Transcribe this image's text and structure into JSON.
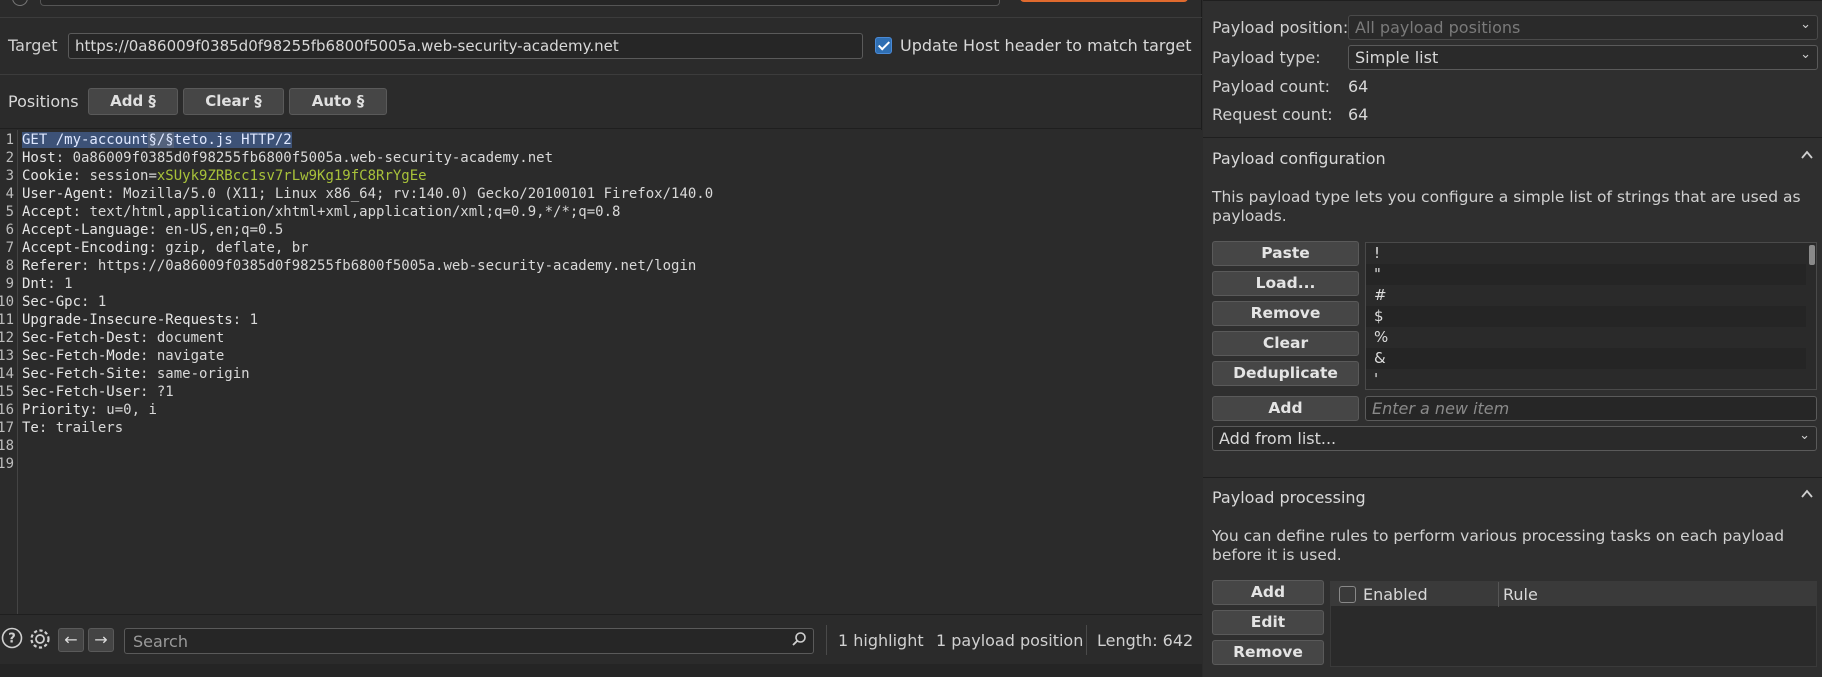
{
  "target": {
    "label": "Target",
    "url": "https://0a86009f0385d0f98255fb6800f5005a.web-security-academy.net",
    "update_host_label": "Update Host header to match target",
    "update_host_checked": true
  },
  "positions": {
    "label": "Positions",
    "add_label": "Add §",
    "clear_label": "Clear §",
    "auto_label": "Auto §"
  },
  "request": {
    "line_numbers": [
      "1",
      "2",
      "3",
      "4",
      "5",
      "6",
      "7",
      "8",
      "9",
      "10",
      "11",
      "12",
      "13",
      "14",
      "15",
      "16",
      "17",
      "18",
      "19"
    ],
    "line1_a": "GET /my-account",
    "line1_marker": "§/§",
    "line1_b": "teto.js HTTP/2",
    "headers": [
      {
        "name": "Host",
        "value": "0a86009f0385d0f98255fb6800f5005a.web-security-academy.net"
      },
      {
        "name": "Cookie",
        "value": "session=",
        "extra": "xSUyk9ZRBcc1sv7rLw9Kg19fC8RrYgEe"
      },
      {
        "name": "User-Agent",
        "value": "Mozilla/5.0 (X11; Linux x86_64; rv:140.0) Gecko/20100101 Firefox/140.0"
      },
      {
        "name": "Accept",
        "value": "text/html,application/xhtml+xml,application/xml;q=0.9,*/*;q=0.8"
      },
      {
        "name": "Accept-Language",
        "value": "en-US,en;q=0.5"
      },
      {
        "name": "Accept-Encoding",
        "value": "gzip, deflate, br"
      },
      {
        "name": "Referer",
        "value": "https://0a86009f0385d0f98255fb6800f5005a.web-security-academy.net/login"
      },
      {
        "name": "Dnt",
        "value": "1"
      },
      {
        "name": "Sec-Gpc",
        "value": "1"
      },
      {
        "name": "Upgrade-Insecure-Requests",
        "value": "1"
      },
      {
        "name": "Sec-Fetch-Dest",
        "value": "document"
      },
      {
        "name": "Sec-Fetch-Mode",
        "value": "navigate"
      },
      {
        "name": "Sec-Fetch-Site",
        "value": "same-origin"
      },
      {
        "name": "Sec-Fetch-User",
        "value": "?1"
      },
      {
        "name": "Priority",
        "value": "u=0, i"
      },
      {
        "name": "Te",
        "value": "trailers"
      }
    ]
  },
  "bottom": {
    "search_placeholder": "Search",
    "highlights": "1 highlight",
    "payload_positions": "1 payload position",
    "length": "Length: 642"
  },
  "payloads": {
    "position_label": "Payload position:",
    "position_value": "All payload positions",
    "type_label": "Payload type:",
    "type_value": "Simple list",
    "count_label": "Payload count:",
    "count_value": "64",
    "request_count_label": "Request count:",
    "request_count_value": "64"
  },
  "configuration": {
    "title": "Payload configuration",
    "description": "This payload type lets you configure a simple list of strings that are used as payloads.",
    "paste": "Paste",
    "load": "Load...",
    "remove": "Remove",
    "clear": "Clear",
    "deduplicate": "Deduplicate",
    "add": "Add",
    "new_item_placeholder": "Enter a new item",
    "add_from_list": "Add from list...",
    "items": [
      "!",
      "\"",
      "#",
      "$",
      "%",
      "&",
      "'"
    ]
  },
  "processing": {
    "title": "Payload processing",
    "description": "You can define rules to perform various processing tasks on each payload before it is used.",
    "add": "Add",
    "edit": "Edit",
    "remove": "Remove",
    "col_enabled": "Enabled",
    "col_rule": "Rule"
  }
}
